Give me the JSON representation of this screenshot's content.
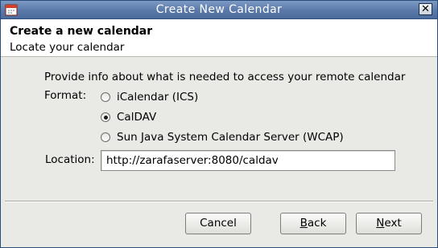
{
  "window": {
    "title": "Create New Calendar",
    "close_symbol": "✕",
    "icon": "calendar-icon"
  },
  "header": {
    "title": "Create a new calendar",
    "description": "Locate your calendar"
  },
  "form": {
    "intro": "Provide info about what is needed to access your remote calendar",
    "format_label": "Format:",
    "options": [
      {
        "label": "iCalendar (ICS)",
        "checked": false
      },
      {
        "label": "CalDAV",
        "checked": true
      },
      {
        "label": "Sun Java System Calendar Server (WCAP)",
        "checked": false
      }
    ],
    "location_label": "Location:",
    "location_value": "http://zarafaserver:8080/caldav"
  },
  "buttons": {
    "cancel": "Cancel",
    "back_mnemonic": "B",
    "back_rest": "ack",
    "next_mnemonic": "N",
    "next_rest": "ext"
  }
}
